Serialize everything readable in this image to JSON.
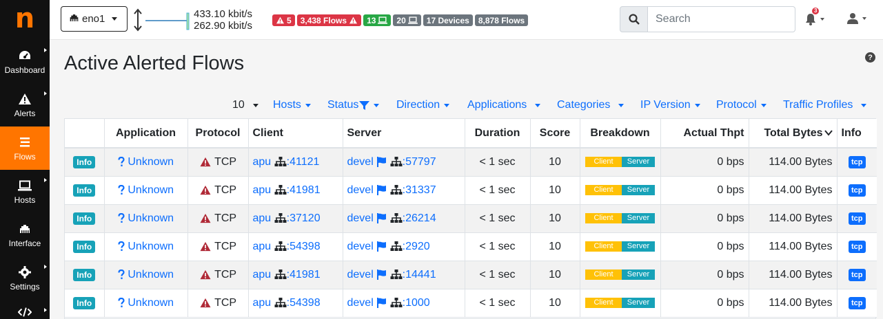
{
  "sidebar": {
    "logo": "n",
    "items": [
      {
        "label": "Dashboard",
        "icon": "gauge-icon"
      },
      {
        "label": "Alerts",
        "icon": "warning-icon"
      },
      {
        "label": "Flows",
        "icon": "stream-icon",
        "active": true
      },
      {
        "label": "Hosts",
        "icon": "laptop-icon"
      },
      {
        "label": "Interface",
        "icon": "ethernet-icon"
      },
      {
        "label": "Settings",
        "icon": "gear-icon"
      },
      {
        "label": "",
        "icon": "code-icon"
      }
    ]
  },
  "topbar": {
    "interface": "eno1",
    "throughput_up": "433.10 kbit/s",
    "throughput_down": "262.90 kbit/s",
    "badges": {
      "alerts": "5",
      "alerted_flows": "3,438 Flows",
      "local_hosts": "13",
      "remote_hosts": "20",
      "devices": "17 Devices",
      "flows": "8,878 Flows"
    },
    "search_placeholder": "Search",
    "notifications_count": "3"
  },
  "page": {
    "title": "Active Alerted Flows",
    "help": "?"
  },
  "filters": {
    "per_page": "10",
    "items": [
      "Hosts",
      "Status",
      "Direction",
      "Applications",
      "Categories",
      "IP Version",
      "Protocol",
      "Traffic Profiles"
    ]
  },
  "table": {
    "columns": [
      "",
      "Application",
      "Protocol",
      "Client",
      "Server",
      "Duration",
      "Score",
      "Breakdown",
      "Actual Thpt",
      "Total Bytes",
      "Info"
    ],
    "breakdown_labels": {
      "client": "Client",
      "server": "Server"
    },
    "rows": [
      {
        "info": "Info",
        "application": "Unknown",
        "protocol": "TCP",
        "client": "apu",
        "client_port": ":41121",
        "server": "devel",
        "server_port": ":57797",
        "duration": "< 1 sec",
        "score": "10",
        "thpt": "0 bps",
        "bytes": "114.00 Bytes",
        "proto_badge": "tcp"
      },
      {
        "info": "Info",
        "application": "Unknown",
        "protocol": "TCP",
        "client": "apu",
        "client_port": ":41981",
        "server": "devel",
        "server_port": ":31337",
        "duration": "< 1 sec",
        "score": "10",
        "thpt": "0 bps",
        "bytes": "114.00 Bytes",
        "proto_badge": "tcp"
      },
      {
        "info": "Info",
        "application": "Unknown",
        "protocol": "TCP",
        "client": "apu",
        "client_port": ":37120",
        "server": "devel",
        "server_port": ":26214",
        "duration": "< 1 sec",
        "score": "10",
        "thpt": "0 bps",
        "bytes": "114.00 Bytes",
        "proto_badge": "tcp"
      },
      {
        "info": "Info",
        "application": "Unknown",
        "protocol": "TCP",
        "client": "apu",
        "client_port": ":54398",
        "server": "devel",
        "server_port": ":2920",
        "duration": "< 1 sec",
        "score": "10",
        "thpt": "0 bps",
        "bytes": "114.00 Bytes",
        "proto_badge": "tcp"
      },
      {
        "info": "Info",
        "application": "Unknown",
        "protocol": "TCP",
        "client": "apu",
        "client_port": ":41981",
        "server": "devel",
        "server_port": ":14441",
        "duration": "< 1 sec",
        "score": "10",
        "thpt": "0 bps",
        "bytes": "114.00 Bytes",
        "proto_badge": "tcp"
      },
      {
        "info": "Info",
        "application": "Unknown",
        "protocol": "TCP",
        "client": "apu",
        "client_port": ":54398",
        "server": "devel",
        "server_port": ":1000",
        "duration": "< 1 sec",
        "score": "10",
        "thpt": "0 bps",
        "bytes": "114.00 Bytes",
        "proto_badge": "tcp"
      }
    ]
  },
  "colors": {
    "accent": "#ff7500",
    "link": "#0d6efd",
    "danger": "#dc3545",
    "info": "#17a2b8",
    "warning": "#ffc107"
  }
}
